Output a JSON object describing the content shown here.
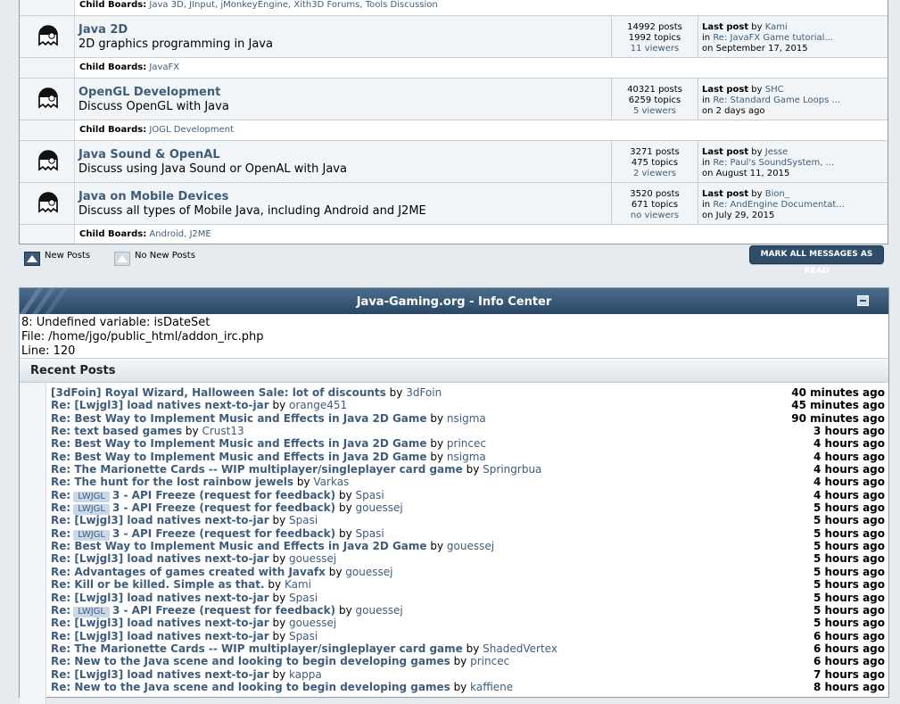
{
  "boards": [
    {
      "child_only": true,
      "child_label": "Child Boards:",
      "children": "Java 3D, JInput, jMonkeyEngine, Xith3D Forums, Tools Discussion"
    },
    {
      "title": "Java 2D",
      "desc": "2D graphics programming in Java",
      "posts": "14992 posts",
      "topics": "1992 topics",
      "viewers": "11 viewers",
      "last_label": "Last post",
      "by": "by",
      "last_user": "Kami",
      "in": "in",
      "last_topic": "Re: JavaFX Game tutorial...",
      "on": "on September 17, 2015",
      "child_label": "Child Boards:",
      "children": "JavaFX"
    },
    {
      "title": "OpenGL Development",
      "desc": "Discuss OpenGL with Java",
      "posts": "40321 posts",
      "topics": "6259 topics",
      "viewers": "5 viewers",
      "last_label": "Last post",
      "by": "by",
      "last_user": "SHC",
      "in": "in",
      "last_topic": "Re: Standard Game Loops ...",
      "on": "on 2 days ago",
      "child_label": "Child Boards:",
      "children": "JOGL Development"
    },
    {
      "title": "Java Sound & OpenAL",
      "desc": "Discuss using Java Sound or OpenAL with Java",
      "posts": "3271 posts",
      "topics": "475 topics",
      "viewers": "2 viewers",
      "last_label": "Last post",
      "by": "by",
      "last_user": "Jesse",
      "in": "in",
      "last_topic": "Re: Paul's SoundSystem, ...",
      "on": "on August 11, 2015"
    },
    {
      "title": "Java on Mobile Devices",
      "desc": "Discuss all types of Mobile Java, including Android and J2ME",
      "posts": "3520 posts",
      "topics": "671 topics",
      "viewers": "no viewers",
      "last_label": "Last post",
      "by": "by",
      "last_user": "Bion_",
      "in": "in",
      "last_topic": "Re: AndEngine Documentat...",
      "on": "on July 29, 2015",
      "child_label": "Child Boards:",
      "children": "Android, J2ME"
    }
  ],
  "legend": {
    "new_posts": "New Posts",
    "no_new_posts": "No New Posts",
    "mark_all": "MARK ALL MESSAGES AS READ"
  },
  "info_center": {
    "title": "Java-Gaming.org - Info Center",
    "error_lines": [
      "8: Undefined variable: isDateSet",
      "File: /home/jgo/public_html/addon_irc.php",
      "Line: 120"
    ],
    "recent_title": "Recent Posts",
    "posts": [
      {
        "topic": "[3dFoin] Royal Wizard, Halloween Sale: lot of discounts",
        "user": "3dFoin",
        "time": "40 minutes ago"
      },
      {
        "topic": "Re: [Lwjgl3] load natives next-to-jar",
        "user": "orange451",
        "time": "45 minutes ago"
      },
      {
        "topic": "Re: Best Way to Implement Music and Effects in Java 2D Game",
        "user": "nsigma",
        "time": "90 minutes ago"
      },
      {
        "topic": "Re: text based games",
        "user": "Crust13",
        "time": "3 hours ago"
      },
      {
        "topic": "Re: Best Way to Implement Music and Effects in Java 2D Game",
        "user": "princec",
        "time": "4 hours ago"
      },
      {
        "topic": "Re: Best Way to Implement Music and Effects in Java 2D Game",
        "user": "nsigma",
        "time": "4 hours ago"
      },
      {
        "topic": "Re: The Marionette Cards -- WIP multiplayer/singleplayer card game",
        "user": "Springrbua",
        "time": "4 hours ago"
      },
      {
        "topic": "Re: The hunt for the lost rainbow jewels",
        "user": "Varkas",
        "time": "4 hours ago"
      },
      {
        "prefix": "Re:",
        "tag": "LWJGL",
        "topic": "3 - API Freeze (request for feedback)",
        "user": "Spasi",
        "time": "4 hours ago"
      },
      {
        "prefix": "Re:",
        "tag": "LWJGL",
        "topic": "3 - API Freeze (request for feedback)",
        "user": "gouessej",
        "time": "5 hours ago"
      },
      {
        "topic": "Re: [Lwjgl3] load natives next-to-jar",
        "user": "Spasi",
        "time": "5 hours ago"
      },
      {
        "prefix": "Re:",
        "tag": "LWJGL",
        "topic": "3 - API Freeze (request for feedback)",
        "user": "Spasi",
        "time": "5 hours ago"
      },
      {
        "topic": "Re: Best Way to Implement Music and Effects in Java 2D Game",
        "user": "gouessej",
        "time": "5 hours ago"
      },
      {
        "topic": "Re: [Lwjgl3] load natives next-to-jar",
        "user": "gouessej",
        "time": "5 hours ago"
      },
      {
        "topic": "Re: Advantages of games created with Javafx",
        "user": "gouessej",
        "time": "5 hours ago"
      },
      {
        "topic": "Re: Kill or be killed. Simple as that.",
        "user": "Kami",
        "time": "5 hours ago"
      },
      {
        "topic": "Re: [Lwjgl3] load natives next-to-jar",
        "user": "Spasi",
        "time": "5 hours ago"
      },
      {
        "prefix": "Re:",
        "tag": "LWJGL",
        "topic": "3 - API Freeze (request for feedback)",
        "user": "gouessej",
        "time": "5 hours ago"
      },
      {
        "topic": "Re: [Lwjgl3] load natives next-to-jar",
        "user": "gouessej",
        "time": "5 hours ago"
      },
      {
        "topic": "Re: [Lwjgl3] load natives next-to-jar",
        "user": "Spasi",
        "time": "6 hours ago"
      },
      {
        "topic": "Re: The Marionette Cards -- WIP multiplayer/singleplayer card game",
        "user": "ShadedVertex",
        "time": "6 hours ago"
      },
      {
        "topic": "Re: New to the Java scene and looking to begin developing games",
        "user": "princec",
        "time": "6 hours ago"
      },
      {
        "topic": "Re: [Lwjgl3] load natives next-to-jar",
        "user": "kappa",
        "time": "7 hours ago"
      },
      {
        "topic": "Re: New to the Java scene and looking to begin developing games",
        "user": "kaffiene",
        "time": "8 hours ago"
      }
    ],
    "by_word": "by"
  },
  "colors": {
    "header": "#2e4e6c",
    "link": "#3f5d7a",
    "page_bg": "#e5ebee"
  }
}
